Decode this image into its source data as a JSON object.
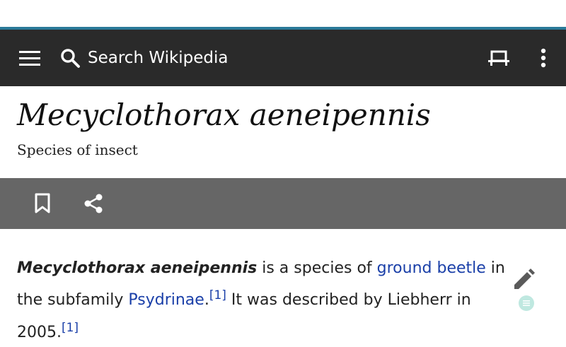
{
  "toolbar": {
    "search_placeholder": "Search Wikipedia",
    "menu_icon": "hamburger-menu-icon",
    "search_icon": "search-icon",
    "reading_list_icon": "reading-list-icon",
    "overflow_icon": "overflow-menu-icon",
    "background": "#2a2a2a",
    "accent": "#2b7a99"
  },
  "article": {
    "title": "Mecyclothorax aeneipennis",
    "description": "Species of insect"
  },
  "actions": {
    "bookmark_icon": "bookmark-icon",
    "share_icon": "share-icon",
    "background": "#666666"
  },
  "body": {
    "bold_title": "Mecyclothorax aeneipennis",
    "text_1": " is a species of ",
    "link_1": "ground beetle",
    "text_2": " in the subfamily ",
    "link_2": "Psydrinae",
    "text_3": ".",
    "ref_1": "[1]",
    "text_4": " It was described by Liebherr in 2005.",
    "ref_2": "[1]",
    "link_color": "#1a3fa8"
  },
  "floating": {
    "edit_icon": "edit-pencil-icon",
    "toc_icon": "table-of-contents-icon",
    "toc_color": "#bfe8e0"
  }
}
